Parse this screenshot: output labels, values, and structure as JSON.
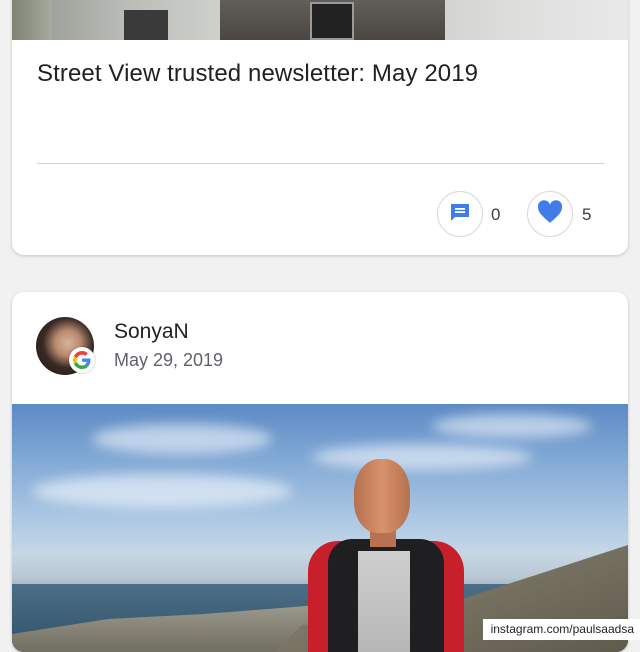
{
  "feed": {
    "post1": {
      "title": "Street View trusted newsletter: May 2019",
      "comment_count": "0",
      "like_count": "5",
      "icons": {
        "comment": "comment-icon",
        "like": "heart-icon"
      }
    },
    "post2": {
      "author": "SonyaN",
      "date": "May 29, 2019",
      "badge_icon": "google-g-icon"
    }
  },
  "watermark": "instagram.com/paulsaadsa",
  "colors": {
    "accent_blue": "#3f7ee8",
    "background": "#f1f1f1",
    "card": "#ffffff"
  }
}
